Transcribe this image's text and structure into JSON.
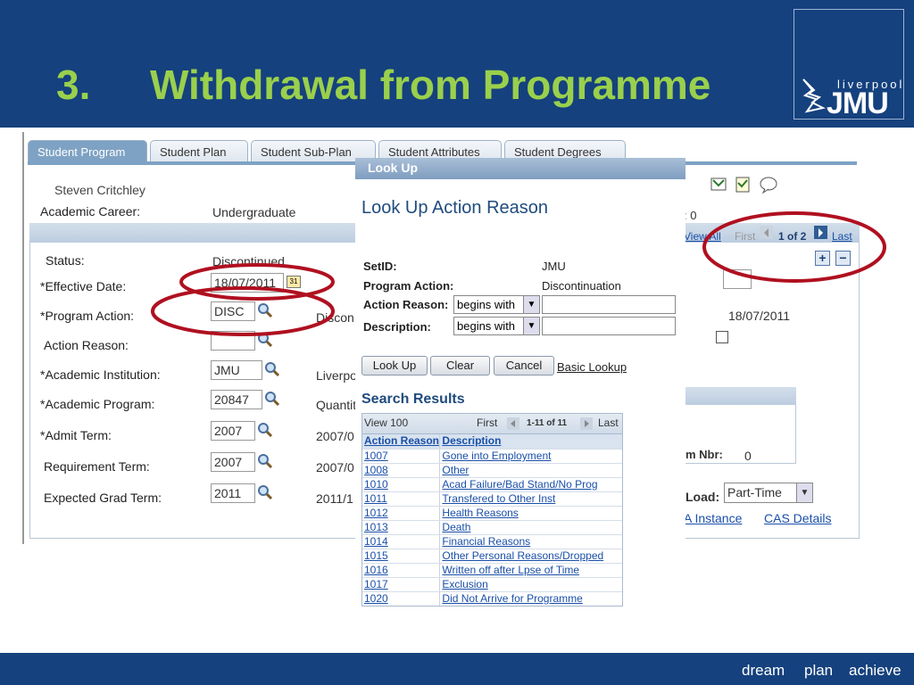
{
  "slide": {
    "number": "3.",
    "title": "Withdrawal from Programme",
    "logo": {
      "small": "liverpool",
      "big": "JMU"
    },
    "footer": [
      "dream",
      "plan",
      "achieve"
    ]
  },
  "tabs": [
    "Student Program",
    "Student Plan",
    "Student Sub-Plan",
    "Student Attributes",
    "Student Degrees"
  ],
  "student": {
    "name": "Steven Critchley",
    "career_label": "Academic Career:",
    "career_value": "Undergraduate"
  },
  "form": {
    "status_label": "Status:",
    "status_value": "Discontinued",
    "effective_date_label": "*Effective Date:",
    "effective_date_value": "18/07/2011",
    "program_action_label": "*Program Action:",
    "program_action_value": "DISC",
    "program_action_desc": "Discon",
    "action_reason_label": "Action Reason:",
    "institution_label": "*Academic Institution:",
    "institution_value": "JMU",
    "institution_desc": "Liverpo",
    "program_label": "*Academic Program:",
    "program_value": "20847",
    "program_desc": "Quantit",
    "admit_term_label": "*Admit Term:",
    "admit_term_value": "2007",
    "admit_term_desc": "2007/0",
    "req_term_label": "Requirement Term:",
    "req_term_value": "2007",
    "req_term_desc": "2007/0",
    "grad_term_label": "Expected Grad Term:",
    "grad_term_value": "2011",
    "grad_term_desc": "2011/1"
  },
  "right": {
    "count_suffix": ": 0",
    "view_all": "View All",
    "first": "First",
    "page": "1 of 2",
    "last": "Last",
    "date": "18/07/2011",
    "nbr_label": "m Nbr:",
    "nbr_value": "0",
    "load_label": "Load:",
    "load_value": "Part-Time",
    "instance_link": "A Instance",
    "cas_link": "CAS Details"
  },
  "popup": {
    "title": "Look Up",
    "heading": "Look Up Action Reason",
    "setid_label": "SetID:",
    "setid_value": "JMU",
    "program_action_label": "Program Action:",
    "program_action_value": "Discontinuation",
    "action_reason_label": "Action Reason:",
    "description_label": "Description:",
    "operator": "begins with",
    "lookup_btn": "Look Up",
    "clear_btn": "Clear",
    "cancel_btn": "Cancel",
    "basic_lookup": "Basic Lookup",
    "results_heading": "Search Results",
    "view100": "View 100",
    "first": "First",
    "range": "1-11 of 11",
    "last": "Last",
    "col_reason": "Action Reason",
    "col_desc": "Description",
    "rows": [
      {
        "code": "1007",
        "desc": "Gone into Employment"
      },
      {
        "code": "1008",
        "desc": "Other"
      },
      {
        "code": "1010",
        "desc": "Acad Failure/Bad Stand/No Prog"
      },
      {
        "code": "1011",
        "desc": "Transfered to Other Inst"
      },
      {
        "code": "1012",
        "desc": "Health Reasons"
      },
      {
        "code": "1013",
        "desc": "Death"
      },
      {
        "code": "1014",
        "desc": "Financial Reasons"
      },
      {
        "code": "1015",
        "desc": "Other Personal Reasons/Dropped"
      },
      {
        "code": "1016",
        "desc": "Written off after Lpse of Time"
      },
      {
        "code": "1017",
        "desc": "Exclusion"
      },
      {
        "code": "1020",
        "desc": "Did Not Arrive for Programme"
      }
    ]
  },
  "colors": {
    "header_bg": "#15417e",
    "title_green": "#9ad04c",
    "annotation_red": "#b01020"
  }
}
